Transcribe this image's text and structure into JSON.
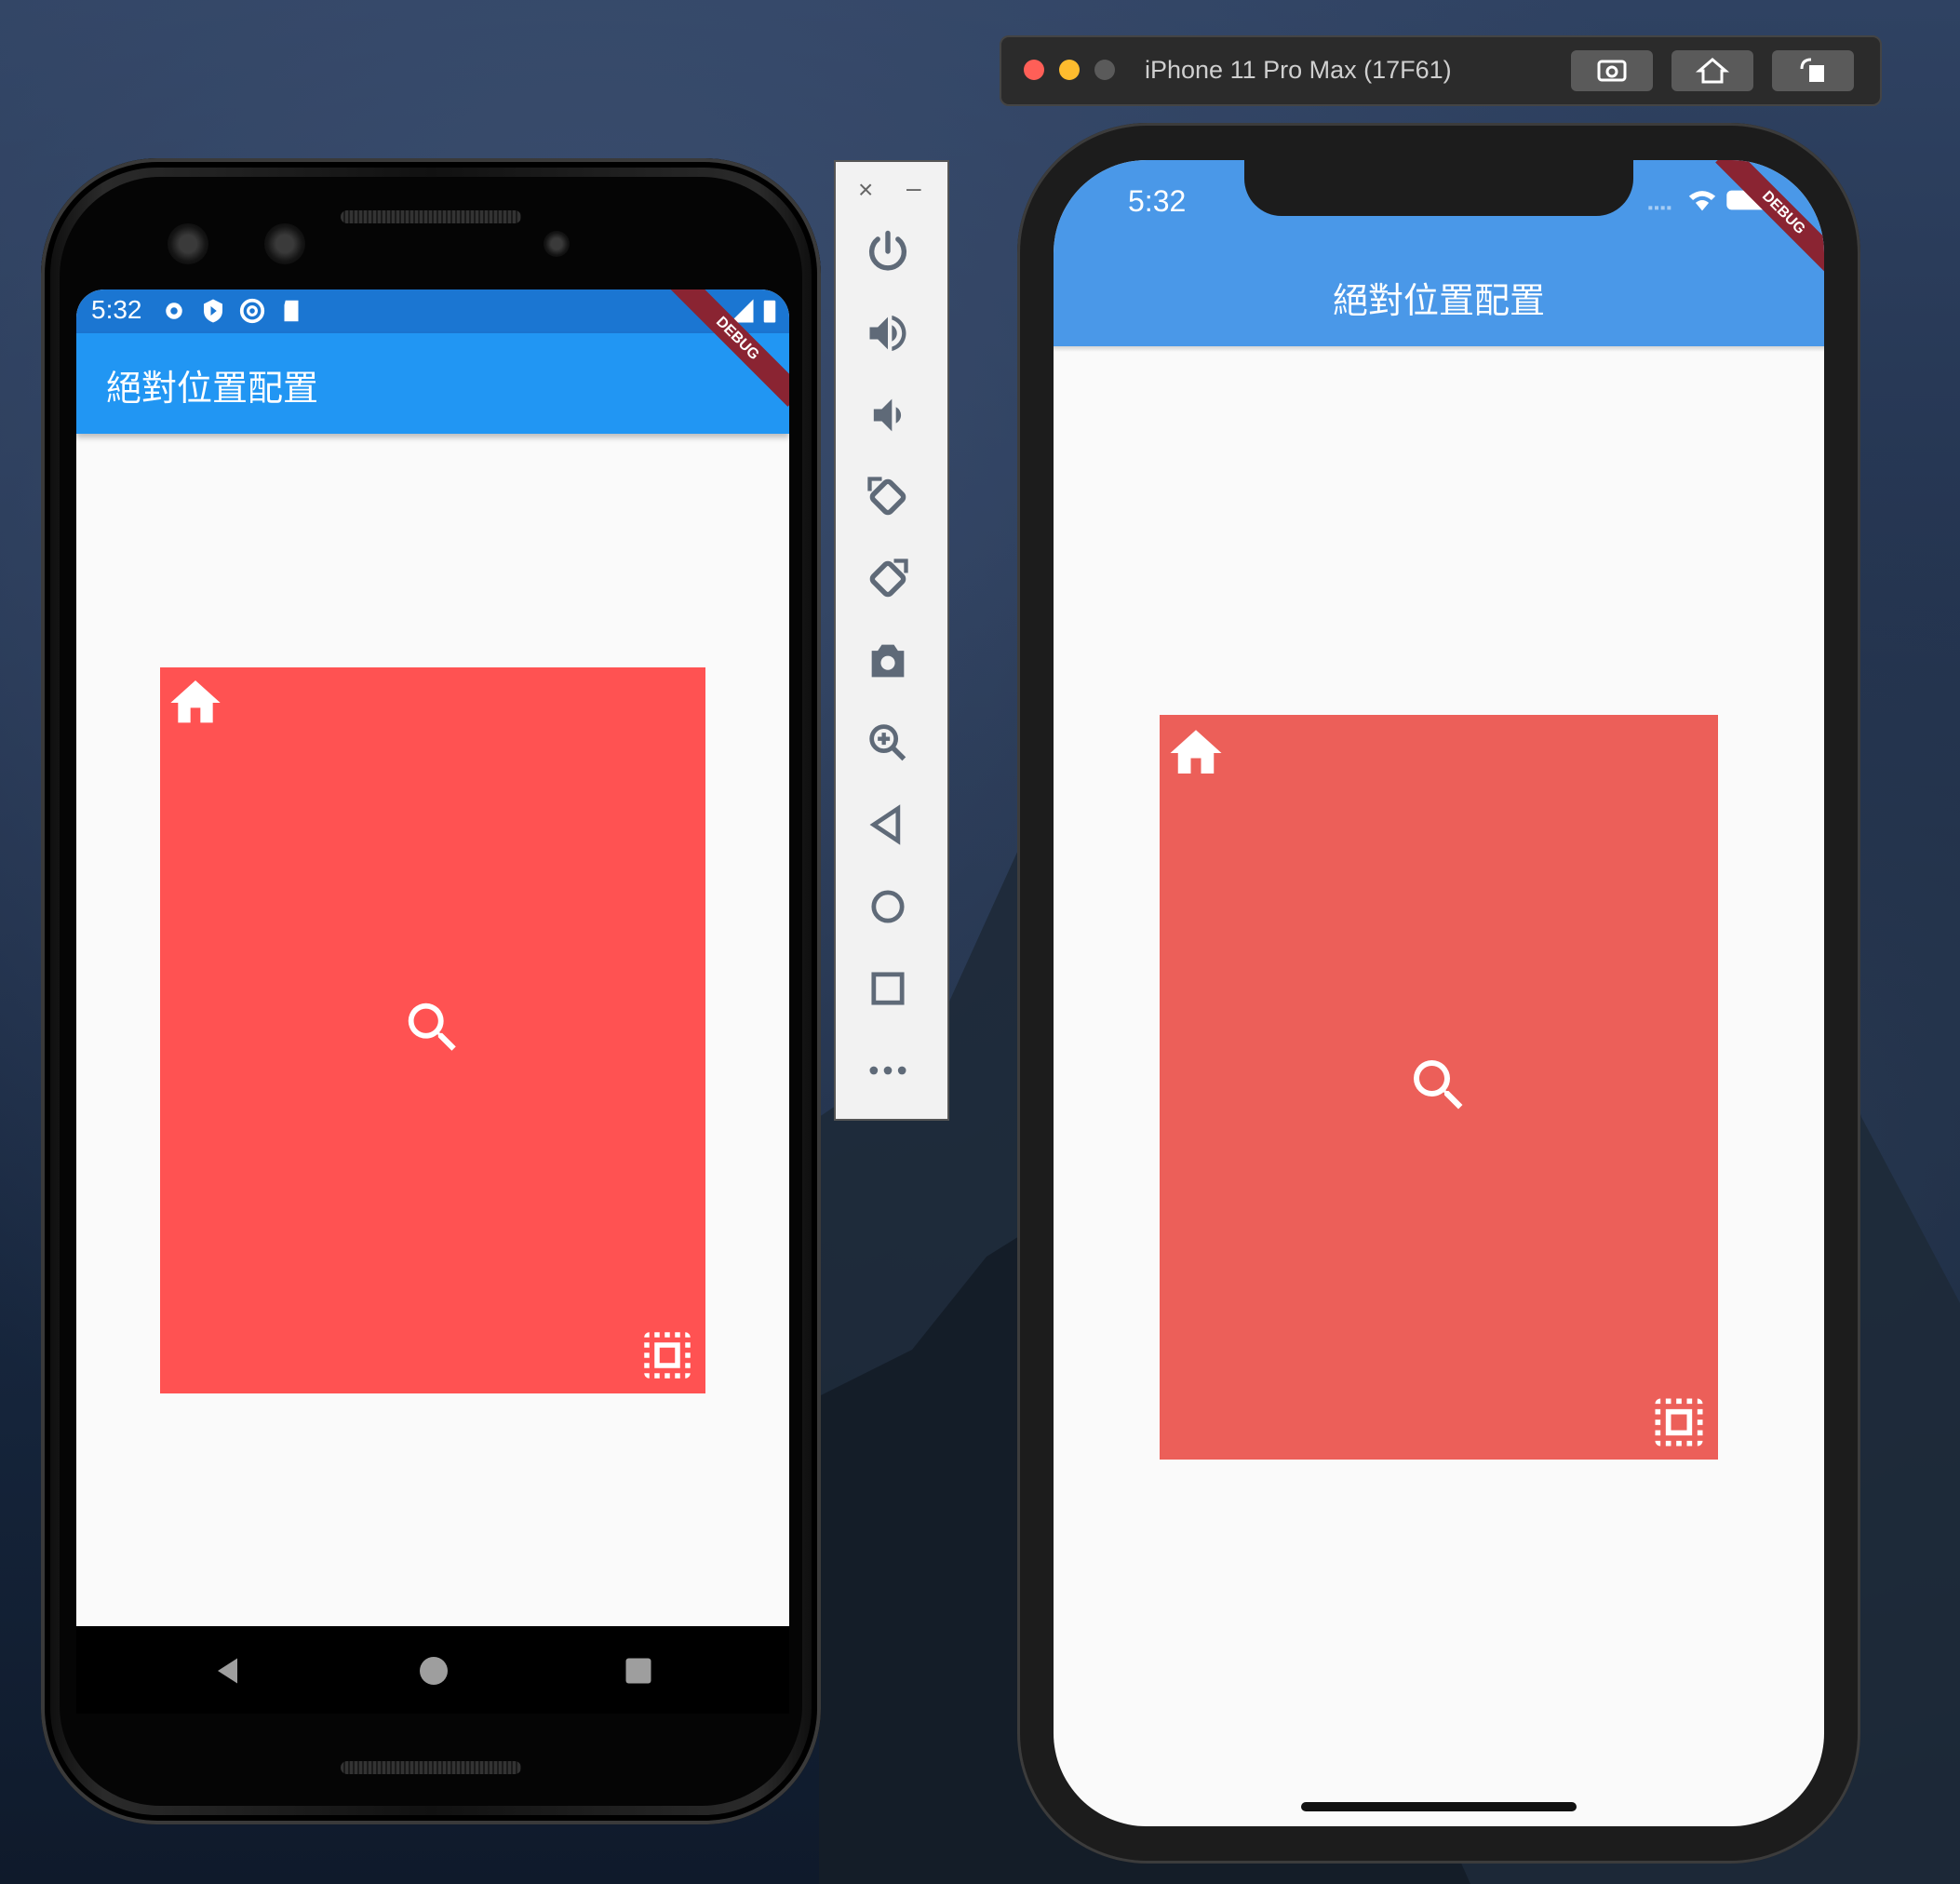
{
  "simulator": {
    "window_title": "iPhone 11 Pro Max (17F61)",
    "buttons": [
      "screenshot-icon",
      "home-icon",
      "rotate-icon"
    ]
  },
  "android": {
    "status_time": "5:32",
    "status_icons": [
      "settings-icon",
      "shield-icon",
      "at-icon",
      "sd-card-icon"
    ],
    "app_title": "絕對位置配置",
    "debug_banner": "DEBUG",
    "box_color": "#ff5252",
    "nav": [
      "back-icon",
      "home-circle-icon",
      "recents-icon"
    ]
  },
  "emulator_toolbar": {
    "window_controls": [
      "×",
      "–"
    ],
    "icons": [
      "power-icon",
      "volume-up-icon",
      "volume-down-icon",
      "rotate-left-icon",
      "rotate-right-icon",
      "camera-icon",
      "zoom-icon",
      "back-icon",
      "home-icon",
      "overview-icon",
      "more-icon"
    ]
  },
  "iphone": {
    "status_time": "5:32",
    "app_title": "絕對位置配置",
    "debug_banner": "DEBUG",
    "box_color": "#ec5f59"
  },
  "box_icons": [
    "home-icon",
    "search-icon",
    "select-all-icon"
  ]
}
